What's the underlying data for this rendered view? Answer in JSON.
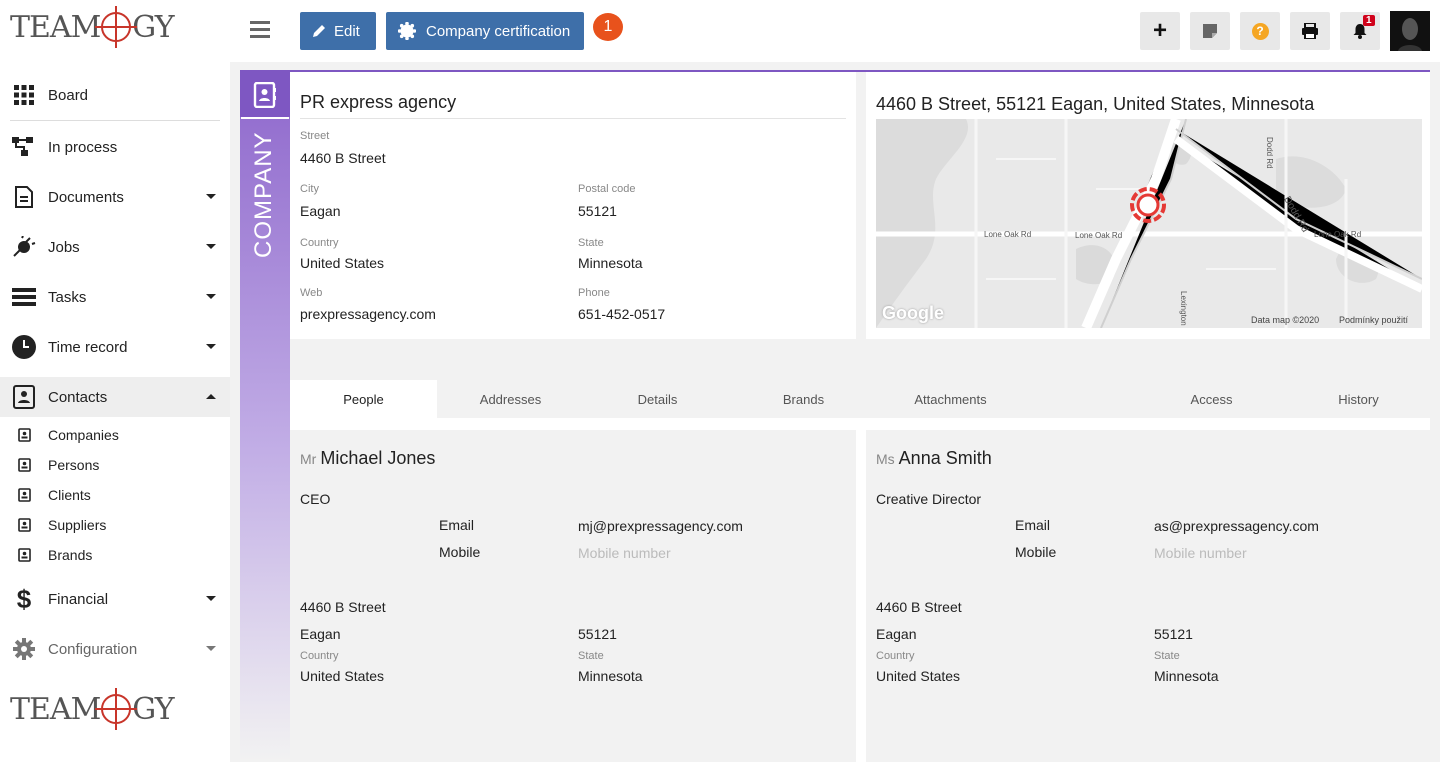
{
  "brand": {
    "logo_left": "TEAM",
    "logo_right": "GY"
  },
  "sidebar": {
    "items": [
      {
        "label": "Board",
        "icon": "grid-icon"
      },
      {
        "label": "In process",
        "icon": "flow-icon"
      },
      {
        "label": "Documents",
        "icon": "document-icon"
      },
      {
        "label": "Jobs",
        "icon": "jobs-icon"
      },
      {
        "label": "Tasks",
        "icon": "tasks-icon"
      },
      {
        "label": "Time record",
        "icon": "clock-icon"
      },
      {
        "label": "Contacts",
        "icon": "contacts-icon"
      },
      {
        "label": "Financial",
        "icon": "dollar-icon"
      },
      {
        "label": "Configuration",
        "icon": "gear-icon"
      }
    ],
    "contacts_sub": [
      "Companies",
      "Persons",
      "Clients",
      "Suppliers",
      "Brands"
    ]
  },
  "toolbar": {
    "edit_label": "Edit",
    "cert_label": "Company certification",
    "cert_badge": "1",
    "notif_badge": "1"
  },
  "company": {
    "side_label": "COMPANY",
    "name": "PR express agency",
    "street_label": "Street",
    "street": "4460  B Street",
    "city_label": "City",
    "city": "Eagan",
    "postal_label": "Postal code",
    "postal": "55121",
    "country_label": "Country",
    "country": "United States",
    "state_label": "State",
    "state": "Minnesota",
    "web_label": "Web",
    "web": "prexpressagency.com",
    "phone_label": "Phone",
    "phone": "651-452-0517"
  },
  "map": {
    "title": "4460 B Street, 55121 Eagan, United States, Minnesota",
    "street_labels": [
      "Lone Oak Rd",
      "Lone Oak Rd",
      "Lone Oak Rd",
      "Dodd Rd",
      "Dodd Rd",
      "Lexington"
    ],
    "google": "Google",
    "data_text": "Data map ©2020",
    "terms_text": "Podmínky použití"
  },
  "tabs": [
    "People",
    "Addresses",
    "Details",
    "Brands",
    "Attachments",
    "Access",
    "History"
  ],
  "people": [
    {
      "salutation": "Mr",
      "name": "Michael Jones",
      "role": "CEO",
      "email_label": "Email",
      "email": "mj@prexpressagency.com",
      "mobile_label": "Mobile",
      "mobile_placeholder": "Mobile number",
      "street": "4460  B Street",
      "city": "Eagan",
      "postal": "55121",
      "country_label": "Country",
      "country": "United States",
      "state_label": "State",
      "state": "Minnesota"
    },
    {
      "salutation": "Ms",
      "name": "Anna Smith",
      "role": "Creative Director",
      "email_label": "Email",
      "email": "as@prexpressagency.com",
      "mobile_label": "Mobile",
      "mobile_placeholder": "Mobile number",
      "street": "4460  B Street",
      "city": "Eagan",
      "postal": "55121",
      "country_label": "Country",
      "country": "United States",
      "state_label": "State",
      "state": "Minnesota"
    }
  ],
  "colors": {
    "accent": "#3e6fa9",
    "purple": "#7e57c2",
    "badge": "#e8521c",
    "active_bg": "#eeeeee"
  }
}
